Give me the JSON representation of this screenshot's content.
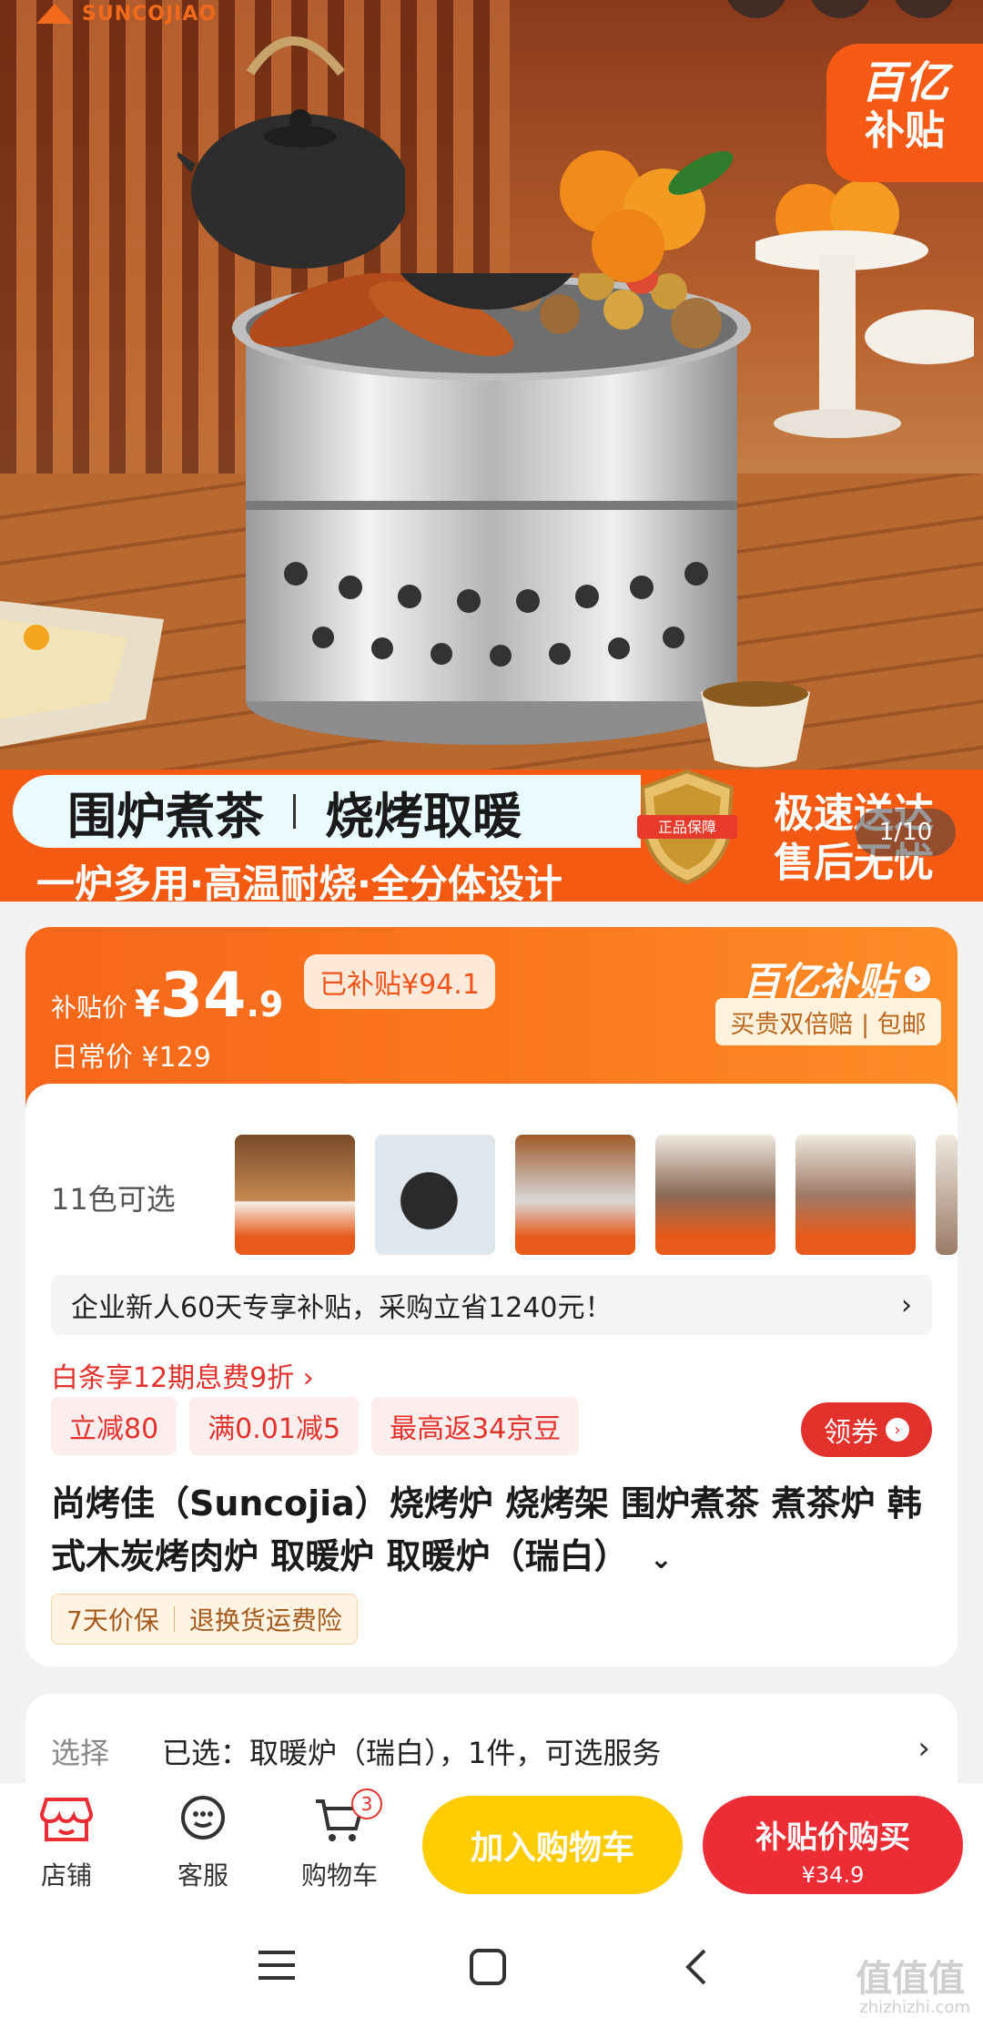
{
  "hero": {
    "logo_text": "SUNCOJIAO",
    "badge_line1": "百亿",
    "badge_line2": "补贴",
    "banner_title_1": "围炉煮茶",
    "banner_title_2": "烧烤取暖",
    "banner_subtitle": "一炉多用·高温耐烧·全分体设计",
    "shield_text": "正品保障",
    "banner_right_1": "极速送达",
    "banner_right_2": "售后无忧",
    "pager": "1/10"
  },
  "price": {
    "label": "补贴价",
    "currency": "¥",
    "integer": "34",
    "decimal": ".9",
    "subsidy_pill": "已补贴¥94.1",
    "daily_label": "日常价",
    "daily_price": "¥129",
    "brand_subsidy": "百亿补贴",
    "promise": "买贵双倍赔 | 包邮"
  },
  "variants": {
    "colors_label": "11色可选",
    "thumbnail_count": 6
  },
  "new_user": {
    "text": "企业新人60天专享补贴，采购立省1240元！",
    "arrow": "›"
  },
  "baitiao": "白条享12期息费9折 ›",
  "coupons": [
    "立减80",
    "满0.01减5",
    "最高返34京豆"
  ],
  "get_coupon": "领券",
  "product_title": "尚烤佳（Suncojia）烧烤炉 烧烤架 围炉煮茶 煮茶炉 韩式木炭烤肉炉 取暖炉 取暖炉（瑞白）",
  "guarantee": [
    "7天价保",
    "退换货运费险"
  ],
  "selection": {
    "label": "选择",
    "value": "已选：取暖炉（瑞白），1件，可选服务",
    "arrow": "›"
  },
  "bottom_bar": {
    "store": "店铺",
    "service": "客服",
    "cart": "购物车",
    "cart_count": "3",
    "add_to_cart": "加入购物车",
    "buy_label": "补贴价购买",
    "buy_price": "¥34.9"
  },
  "watermark": {
    "main": "值值值",
    "url": "zhizhizhi.com"
  },
  "colors": {
    "accent_orange": "#f7661a",
    "buy_red": "#ec2d35",
    "cart_yellow": "#ffcc00"
  }
}
